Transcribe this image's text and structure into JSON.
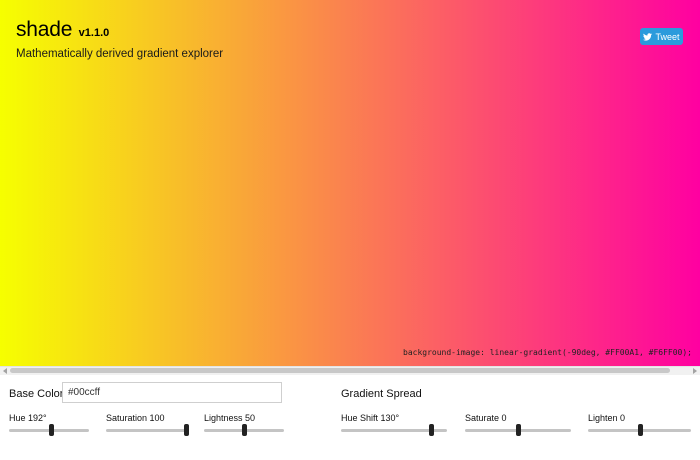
{
  "app": {
    "title": "shade",
    "version": "v1.1.0",
    "subtitle": "Mathematically derived gradient explorer"
  },
  "tweet": {
    "label": "Tweet",
    "icon": "twitter-bird-icon"
  },
  "gradient": {
    "css": "background-image: linear-gradient(-90deg, #FF00A1, #F6FF00);",
    "start": "#F6FF00",
    "end": "#FF00A1"
  },
  "controls": {
    "base_color_label": "Base Color",
    "base_color_value": "#00ccff",
    "gradient_spread_label": "Gradient Spread",
    "sliders": [
      {
        "label": "Hue 192°",
        "fraction": 0.53
      },
      {
        "label": "Saturation 100",
        "fraction": 1.0
      },
      {
        "label": "Lightness 50",
        "fraction": 0.5
      },
      {
        "label": "Hue Shift 130°",
        "fraction": 0.85
      },
      {
        "label": "Saturate 0",
        "fraction": 0.5
      },
      {
        "label": "Lighten 0",
        "fraction": 0.5
      }
    ]
  }
}
